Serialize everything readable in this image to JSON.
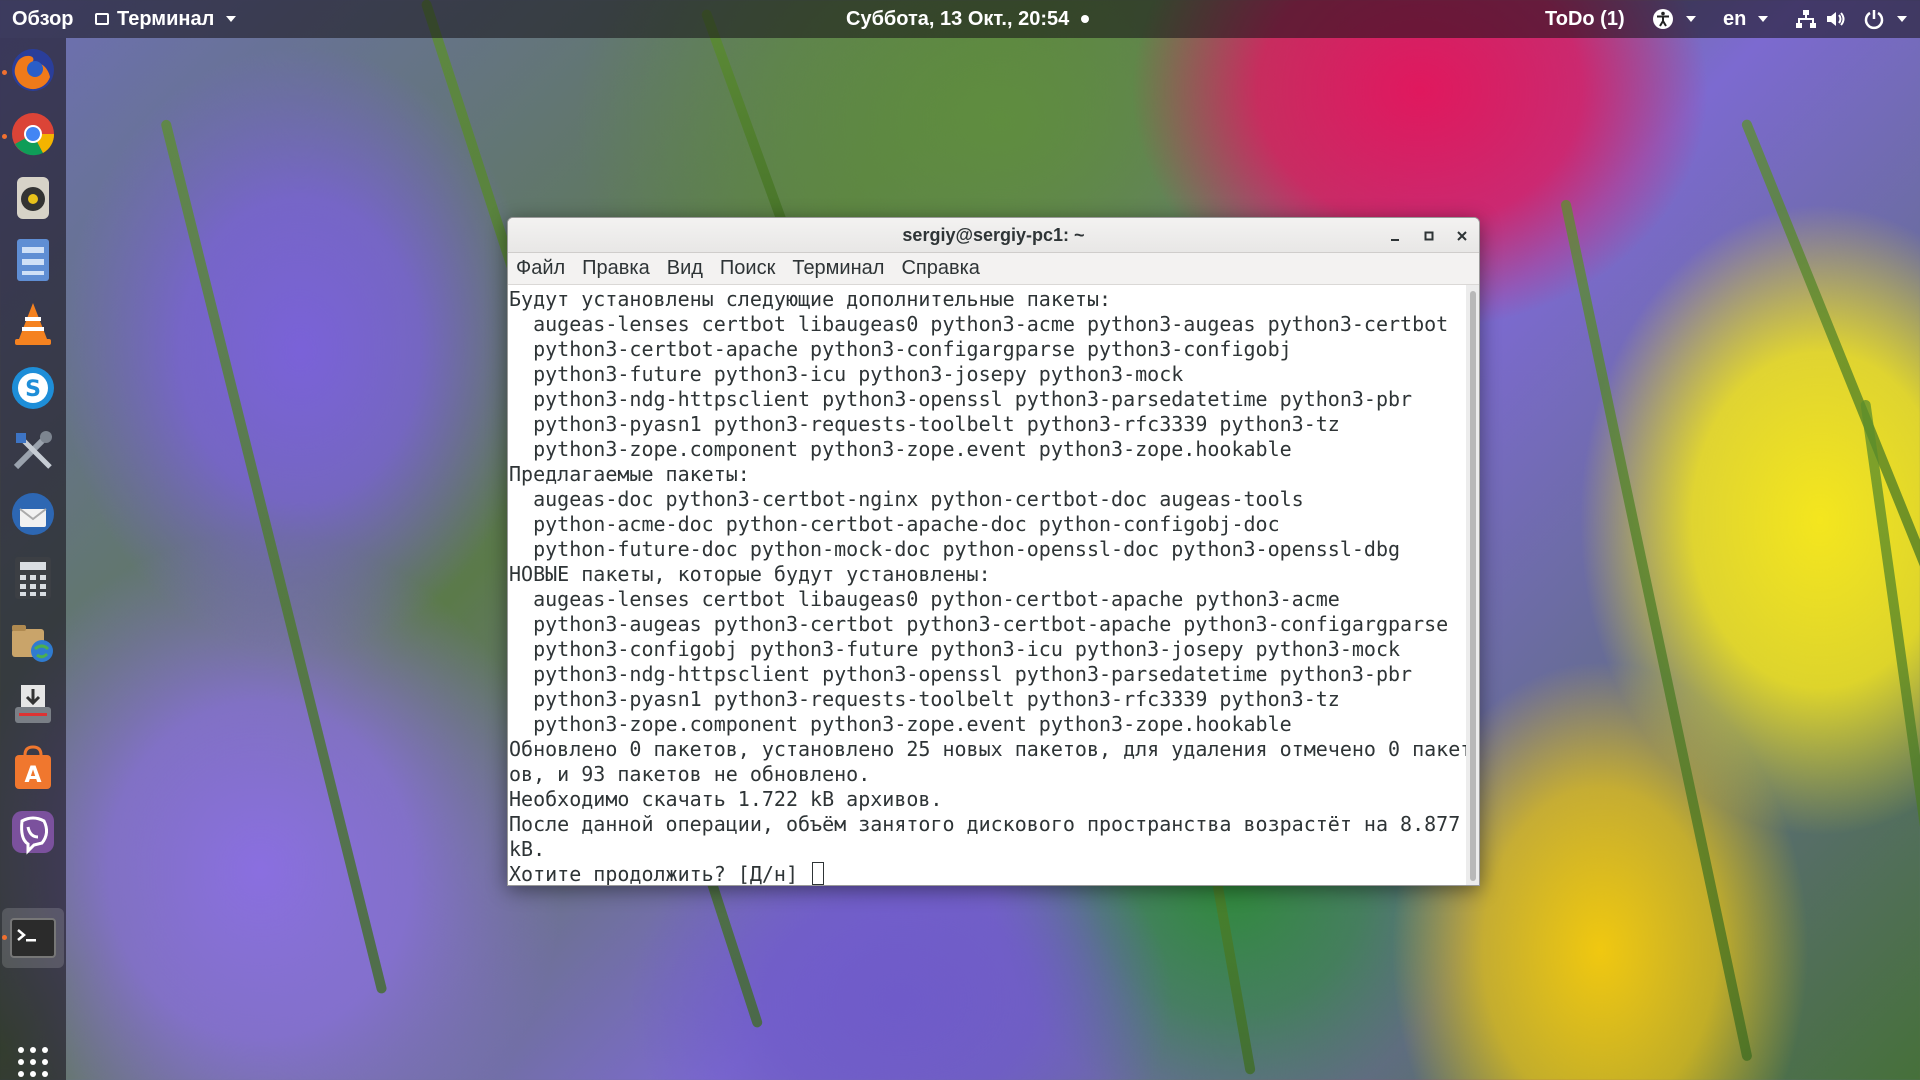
{
  "topbar": {
    "overview": "Обзор",
    "app_menu": "Терминал",
    "clock": "Суббота, 13 Окт., 20:54",
    "todo": "ToDo (1)",
    "lang": "en"
  },
  "dock": {
    "apps": [
      "firefox-icon",
      "chrome-icon",
      "rhythmbox-icon",
      "files-icon",
      "vlc-icon",
      "skype-icon",
      "tools-icon",
      "thunderbird-icon",
      "calculator-icon",
      "filezilla-icon",
      "scanner-icon",
      "software-center-icon",
      "viber-icon",
      "terminal-icon",
      "app-grid-icon"
    ]
  },
  "window": {
    "title": "sergiy@sergiy-pc1: ~",
    "menu": {
      "file": "Файл",
      "edit": "Правка",
      "view": "Вид",
      "search": "Поиск",
      "terminal": "Терминал",
      "help": "Справка"
    },
    "lines": [
      "Будут установлены следующие дополнительные пакеты:",
      "  augeas-lenses certbot libaugeas0 python3-acme python3-augeas python3-certbot",
      "  python3-certbot-apache python3-configargparse python3-configobj",
      "  python3-future python3-icu python3-josepy python3-mock",
      "  python3-ndg-httpsclient python3-openssl python3-parsedatetime python3-pbr",
      "  python3-pyasn1 python3-requests-toolbelt python3-rfc3339 python3-tz",
      "  python3-zope.component python3-zope.event python3-zope.hookable",
      "Предлагаемые пакеты:",
      "  augeas-doc python3-certbot-nginx python-certbot-doc augeas-tools",
      "  python-acme-doc python-certbot-apache-doc python-configobj-doc",
      "  python-future-doc python-mock-doc python-openssl-doc python3-openssl-dbg",
      "НОВЫЕ пакеты, которые будут установлены:",
      "  augeas-lenses certbot libaugeas0 python-certbot-apache python3-acme",
      "  python3-augeas python3-certbot python3-certbot-apache python3-configargparse",
      "  python3-configobj python3-future python3-icu python3-josepy python3-mock",
      "  python3-ndg-httpsclient python3-openssl python3-parsedatetime python3-pbr",
      "  python3-pyasn1 python3-requests-toolbelt python3-rfc3339 python3-tz",
      "  python3-zope.component python3-zope.event python3-zope.hookable",
      "Обновлено 0 пакетов, установлено 25 новых пакетов, для удаления отмечено 0 пакет",
      "ов, и 93 пакетов не обновлено.",
      "Необходимо скачать 1.722 kB архивов.",
      "После данной операции, объём занятого дискового пространства возрастёт на 8.877",
      "kB."
    ],
    "prompt": "Хотите продолжить? [Д/н] "
  }
}
